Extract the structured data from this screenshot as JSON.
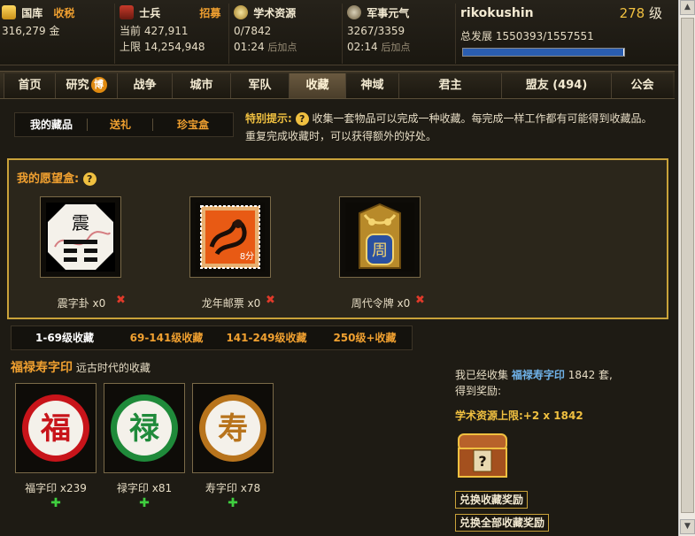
{
  "top": {
    "treasury": {
      "title": "国库",
      "action": "收税",
      "value": "316,279",
      "unit": "金"
    },
    "soldiers": {
      "title": "士兵",
      "action": "招募",
      "current_label": "当前",
      "current": "427,911",
      "cap_label": "上限",
      "cap": "14,254,948"
    },
    "academic": {
      "title": "学术资源",
      "value": "0/7842",
      "timer": "01:24",
      "timer_note": "后加点"
    },
    "military": {
      "title": "军事元气",
      "value": "3267/3359",
      "timer": "02:14",
      "timer_note": "后加点"
    },
    "player": {
      "name": "rikokushin",
      "level": "278",
      "level_unit": "级",
      "dev_label": "总发展",
      "dev_value": "1550393/1557551",
      "dev_fraction": 0.9954
    }
  },
  "nav": {
    "items": [
      "首页",
      "研究",
      "战争",
      "城市",
      "军队",
      "收藏",
      "神域",
      "君主",
      "盟友 (494)",
      "公会"
    ],
    "research_badge": "博",
    "active": "收藏"
  },
  "subtabs": [
    "我的藏品",
    "送礼",
    "珍宝盒"
  ],
  "tip": {
    "label": "特别提示:",
    "text": "收集一套物品可以完成一种收藏。每完成一样工作都有可能得到收藏品。重复完成收藏时，可以获得额外的好处。"
  },
  "wishbox": {
    "title": "我的愿望盒:",
    "items": [
      {
        "label": "震字卦 x0",
        "icon": "trigram-zhen-icon",
        "glyph": "震"
      },
      {
        "label": "龙年邮票 x0",
        "icon": "dragon-stamp-icon",
        "glyph": "8分"
      },
      {
        "label": "周代令牌 x0",
        "icon": "zhou-token-icon",
        "glyph": "周"
      }
    ],
    "remove_glyph": "✖"
  },
  "level_tabs": [
    "1-69级收藏",
    "69-141级收藏",
    "141-249级收藏",
    "250级+收藏"
  ],
  "set": {
    "name": "福禄寿字印",
    "desc": "远古时代的收藏",
    "items": [
      {
        "label": "福字印 x239",
        "glyph": "福",
        "color": "#c8141a"
      },
      {
        "label": "禄字印 x81",
        "glyph": "禄",
        "color": "#1f8a3a"
      },
      {
        "label": "寿字印 x78",
        "glyph": "寿",
        "color": "#b8741c"
      }
    ],
    "plus_glyph": "✚"
  },
  "collect": {
    "prefix": "我已经收集",
    "set_name": "福禄寿字印",
    "count_text": "1842 套,",
    "line2": "得到奖励:",
    "reward": "学术资源上限:+2 x 1842",
    "chest_glyph": "?",
    "btn_one": "兑换收藏奖励",
    "btn_all": "兑换全部收藏奖励"
  },
  "colors": {
    "gold": "#c9a23a",
    "accent": "#f0a030",
    "link": "#6fb2e8",
    "remove": "#e03a2a",
    "add": "#3fcf3f"
  }
}
